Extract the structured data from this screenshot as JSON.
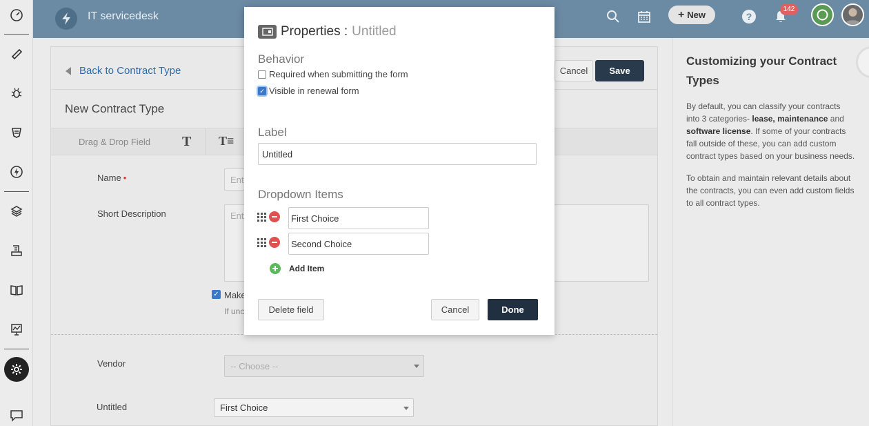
{
  "app": {
    "title": "IT servicedesk"
  },
  "topbar": {
    "new_label": "New",
    "notifications_count": "142"
  },
  "nav": {
    "icons": [
      "dashboard-icon",
      "tickets-icon",
      "problems-icon",
      "changes-icon",
      "releases-icon",
      "assets-icon",
      "contracts-icon",
      "solutions-icon",
      "reports-icon",
      "admin-icon",
      "chat-icon"
    ]
  },
  "main": {
    "back_label": "Back to Contract Type",
    "cancel_label": "Cancel",
    "save_label": "Save",
    "page_title": "New Contract Type",
    "toolbar_label": "Drag & Drop Field",
    "fields": {
      "name_label": "Name",
      "name_placeholder": "Ent",
      "short_desc_label": "Short Description",
      "short_desc_placeholder": "Ent",
      "make_label": "Make",
      "if_unc_text": "If unc",
      "vendor_label": "Vendor",
      "vendor_value": "-- Choose --",
      "untitled_label": "Untitled",
      "untitled_value": "First Choice"
    }
  },
  "help": {
    "title": "Customizing your Contract Types",
    "p1_a": "By default, you can classify your contracts into 3 categories- ",
    "p1_b": "lease, maintenance",
    "p1_c": " and ",
    "p1_d": "software license",
    "p1_e": ". If some of your contracts fall outside of these, you can add custom contract types based on your business needs.",
    "p2": "To obtain and maintain relevant details about the contracts, you can even add custom fields to all contract types."
  },
  "modal": {
    "title": "Properties :",
    "title_sub": "Untitled",
    "behavior_heading": "Behavior",
    "required_label": "Required when submitting the form",
    "required_checked": false,
    "visible_label": "Visible in renewal form",
    "visible_checked": true,
    "label_heading": "Label",
    "label_value": "Untitled",
    "dropdown_heading": "Dropdown Items",
    "items": [
      {
        "value": "First Choice"
      },
      {
        "value": "Second Choice"
      }
    ],
    "add_item_label": "Add Item",
    "delete_label": "Delete field",
    "cancel_label": "Cancel",
    "done_label": "Done"
  }
}
